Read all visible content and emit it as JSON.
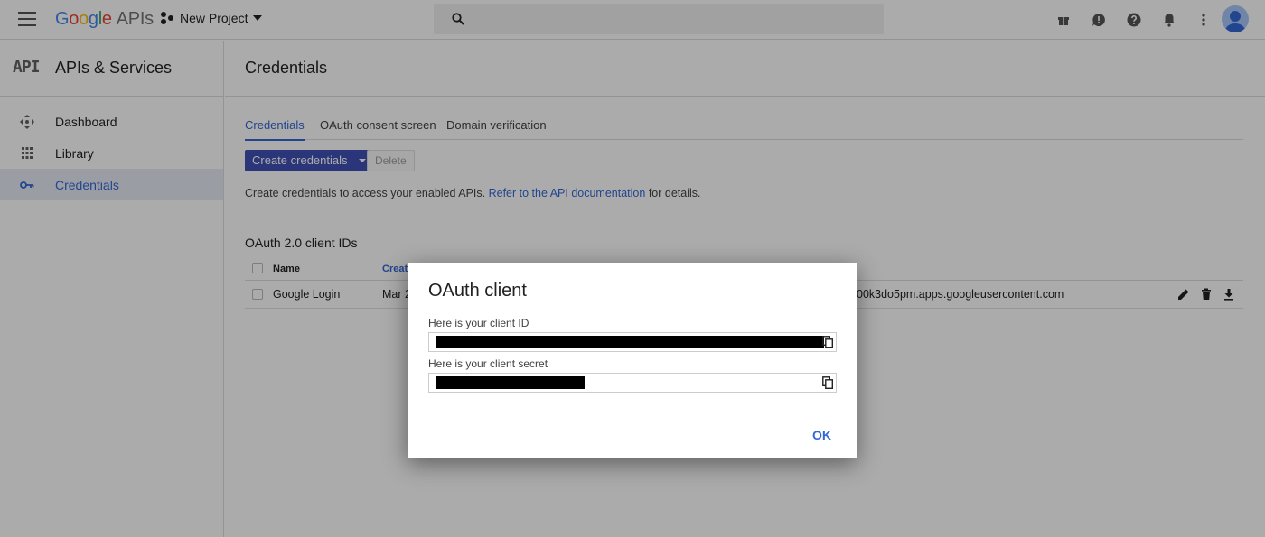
{
  "topbar": {
    "logo_google": [
      "G",
      "o",
      "o",
      "g",
      "l",
      "e"
    ],
    "logo_apis": "APIs",
    "project_name": "New Project"
  },
  "sidebar": {
    "badge": "API",
    "title": "APIs & Services",
    "items": [
      {
        "label": "Dashboard",
        "icon": "dashboard-icon"
      },
      {
        "label": "Library",
        "icon": "library-icon"
      },
      {
        "label": "Credentials",
        "icon": "key-icon",
        "active": true
      }
    ]
  },
  "main": {
    "title": "Credentials",
    "tabs": [
      {
        "label": "Credentials",
        "active": true
      },
      {
        "label": "OAuth consent screen"
      },
      {
        "label": "Domain verification"
      }
    ],
    "create_label": "Create credentials",
    "delete_label": "Delete",
    "help_prefix": "Create credentials to access your enabled APIs.",
    "help_link": "Refer to the API documentation",
    "help_suffix": "for details.",
    "section_title": "OAuth 2.0 client IDs",
    "table": {
      "headers": {
        "name": "Name",
        "created": "Creat"
      },
      "rows": [
        {
          "name": "Google Login",
          "created": "Mar 2",
          "client_id": "00k3do5pm.apps.googleusercontent.com"
        }
      ]
    }
  },
  "dialog": {
    "title": "OAuth client",
    "client_id_label": "Here is your client ID",
    "client_secret_label": "Here is your client secret",
    "ok_label": "OK"
  },
  "colors": {
    "primary": "#3f51b5",
    "link": "#3367d6"
  }
}
